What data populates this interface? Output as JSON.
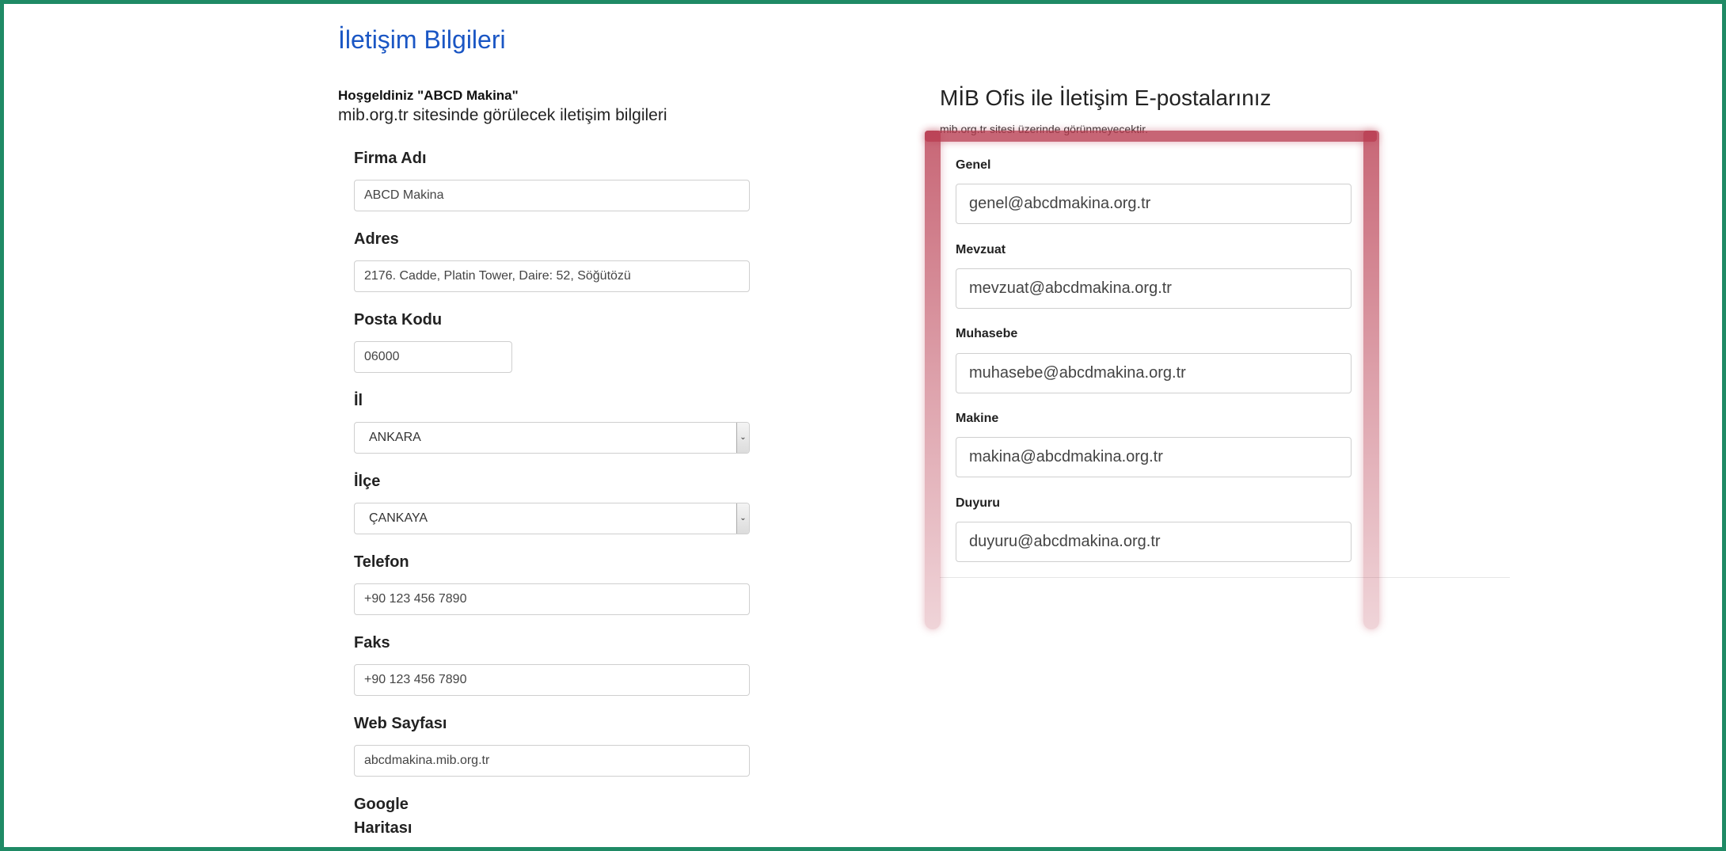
{
  "page": {
    "title": "İletişim Bilgileri",
    "welcome": "Hoşgeldiniz \"ABCD Makina\"",
    "subtitle": "mib.org.tr sitesinde görülecek iletişim bilgileri"
  },
  "form": {
    "firma_adi": {
      "label": "Firma Adı",
      "value": "ABCD Makina"
    },
    "adres": {
      "label": "Adres",
      "value": "2176. Cadde, Platin Tower, Daire: 52, Söğütözü"
    },
    "posta_kodu": {
      "label": "Posta Kodu",
      "value": "06000"
    },
    "il": {
      "label": "İl",
      "value": "ANKARA"
    },
    "ilce": {
      "label": "İlçe",
      "value": "ÇANKAYA"
    },
    "telefon": {
      "label": "Telefon",
      "value": "+90 123 456 7890"
    },
    "faks": {
      "label": "Faks",
      "value": "+90 123 456 7890"
    },
    "web": {
      "label": "Web Sayfası",
      "value": "abcdmakina.mib.org.tr"
    },
    "google_haritasi": {
      "label_line1": "Google",
      "label_line2": "Haritası"
    }
  },
  "emails": {
    "title": "MİB Ofis ile İletişim E-postalarınız",
    "note": "mib.org.tr sitesi üzerinde görünmeyecektir.",
    "genel": {
      "label": "Genel",
      "value": "genel@abcdmakina.org.tr"
    },
    "mevzuat": {
      "label": "Mevzuat",
      "value": "mevzuat@abcdmakina.org.tr"
    },
    "muhasebe": {
      "label": "Muhasebe",
      "value": "muhasebe@abcdmakina.org.tr"
    },
    "makine": {
      "label": "Makine",
      "value": "makina@abcdmakina.org.tr"
    },
    "duyuru": {
      "label": "Duyuru",
      "value": "duyuru@abcdmakina.org.tr"
    }
  },
  "colors": {
    "frame": "#1f8a65",
    "title": "#1a56c4",
    "highlight": "#b83b4f"
  }
}
